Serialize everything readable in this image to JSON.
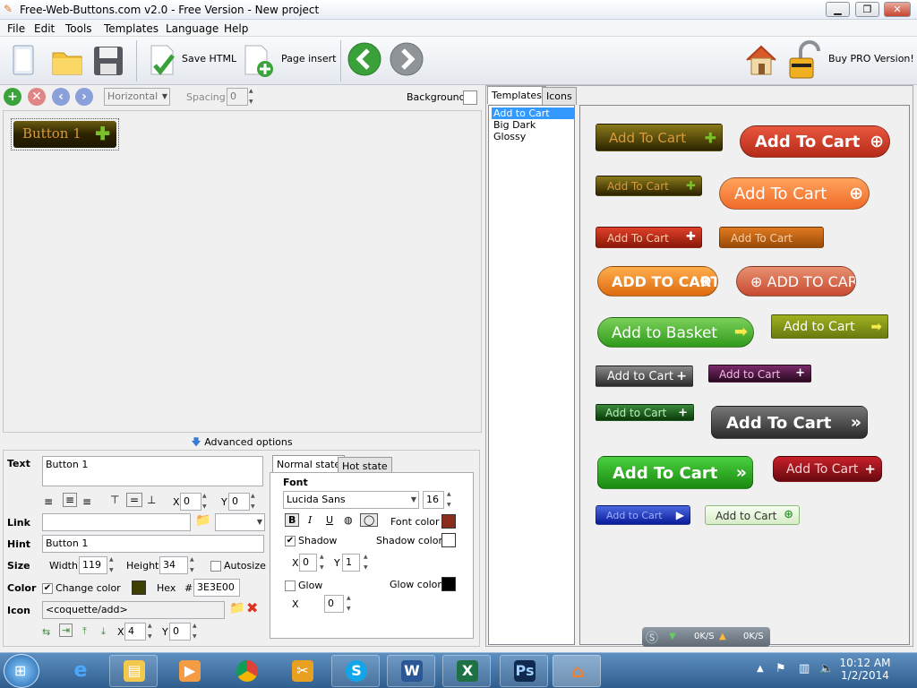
{
  "window": {
    "title": "Free-Web-Buttons.com v2.0 - Free Version - New project",
    "minimize": "▁",
    "maximize": "❐",
    "close": "✕"
  },
  "menu": [
    "File",
    "Edit",
    "Tools",
    "Templates",
    "Language",
    "Help"
  ],
  "toolbar": {
    "save_html": "Save HTML",
    "page_insert": "Page insert",
    "buy_pro": "Buy PRO Version!"
  },
  "left_toolbar": {
    "orientation": "Horizontal",
    "spacing_label": "Spacing",
    "spacing_value": "0",
    "background_label": "Background"
  },
  "canvas": {
    "button_label": "Button 1"
  },
  "advanced": "Advanced options",
  "props": {
    "text_label": "Text",
    "text_value": "Button 1",
    "x_label": "X",
    "x_value": "0",
    "y_label": "Y",
    "y_value": "0",
    "link_label": "Link",
    "link_value": "",
    "hint_label": "Hint",
    "hint_value": "Button 1",
    "size_label": "Size",
    "width_label": "Width",
    "width_value": "119",
    "height_label": "Height",
    "height_value": "34",
    "autosize_label": "Autosize",
    "color_label": "Color",
    "change_color_label": "Change color",
    "color_hex_label": "Hex",
    "hash": "#",
    "hex_value": "3E3E00",
    "swatch_color": "#3e3e00",
    "icon_label": "Icon",
    "icon_value": "<coquette/add>",
    "icon_x_label": "X",
    "icon_x_value": "4",
    "icon_y_label": "Y",
    "icon_y_value": "0"
  },
  "state": {
    "tab_normal": "Normal state",
    "tab_hot": "Hot state",
    "font_group": "Font",
    "font_name": "Lucida Sans",
    "font_size": "16",
    "font_color_label": "Font color",
    "font_color": "#8b2d1c",
    "shadow_label": "Shadow",
    "shadow_color_label": "Shadow color",
    "x_label": "X",
    "x_value": "0",
    "y_label": "Y",
    "y_value": "1",
    "glow_label": "Glow",
    "glow_color_label": "Glow color",
    "glow_x_label": "X",
    "glow_x_value": "0"
  },
  "right": {
    "tab_templates": "Templates",
    "tab_icons": "Icons",
    "templates": [
      "Add to Cart",
      "Big Dark",
      "Glossy"
    ]
  },
  "previews": [
    "Add To Cart",
    "Add To Cart",
    "Add To Cart",
    "Add To Cart",
    "Add To Cart",
    "Add To Cart",
    "ADD TO CART",
    "ADD TO CART",
    "Add to Basket",
    "Add to Cart",
    "Add to Cart",
    "Add to Cart",
    "Add to Cart",
    "Add To Cart",
    "Add To Cart",
    "Add To Cart",
    "Add to Cart",
    "Add to Cart"
  ],
  "network": {
    "down": "0K/S",
    "up": "0K/S"
  },
  "taskbar": {
    "time": "10:12 AM",
    "date": "1/2/2014"
  }
}
